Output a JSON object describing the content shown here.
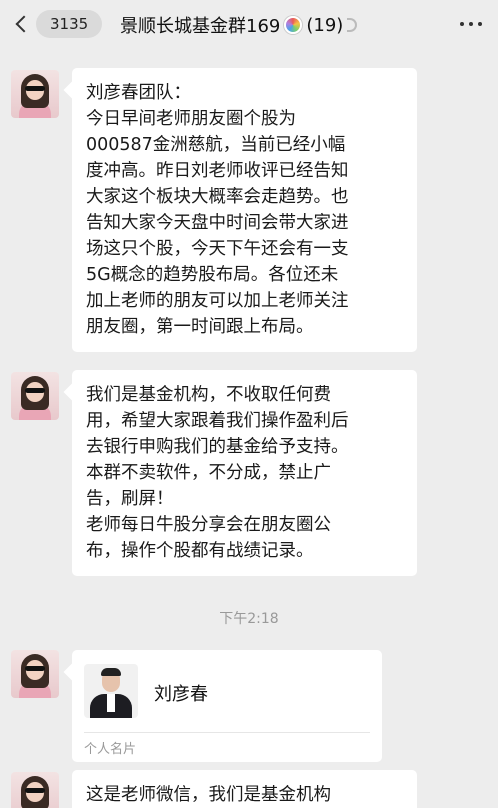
{
  "header": {
    "back_count": "3135",
    "title": "景顺长城基金群169",
    "member_count": "(19)"
  },
  "messages": [
    {
      "lines": [
        "刘彦春团队：",
        "今日早间老师朋友圈个股为",
        "000587金洲慈航，当前已经小幅",
        "度冲高。昨日刘老师收评已经告知",
        "大家这个板块大概率会走趋势。也",
        "告知大家今天盘中时间会带大家进",
        "场这只个股，今天下午还会有一支",
        "5G概念的趋势股布局。各位还未",
        "加上老师的朋友可以加上老师关注",
        "朋友圈，第一时间跟上布局。"
      ]
    },
    {
      "lines": [
        "我们是基金机构，不收取任何费",
        "用，希望大家跟着我们操作盈利后",
        "去银行申购我们的基金给予支持。",
        "本群不卖软件，不分成，禁止广",
        "告，刷屏！",
        "老师每日牛股分享会在朋友圈公",
        "布，操作个股都有战绩记录。"
      ]
    }
  ],
  "timestamp": "下午2:18",
  "card": {
    "name": "刘彦春",
    "type_label": "个人名片"
  },
  "partial_message": "这是老师微信，我们是基金机构"
}
